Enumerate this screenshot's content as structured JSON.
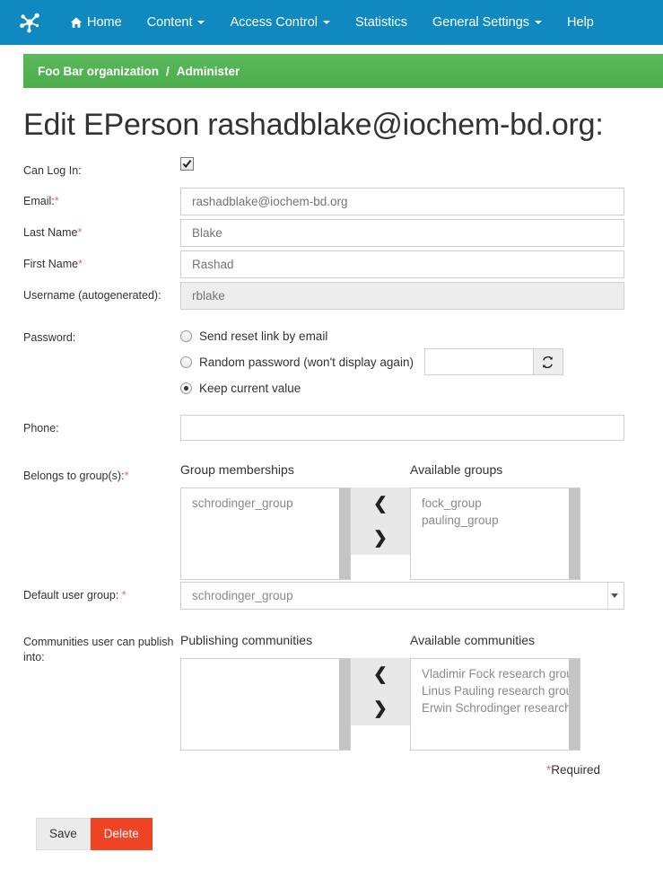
{
  "navbar": {
    "brand_icon": "molecule-logo-icon",
    "bg_color": "#1089c0",
    "items": [
      {
        "label": "Home",
        "icon": "home-icon",
        "caret": false
      },
      {
        "label": "Content",
        "icon": null,
        "caret": true
      },
      {
        "label": "Access Control",
        "icon": null,
        "caret": true
      },
      {
        "label": "Statistics",
        "icon": null,
        "caret": false
      },
      {
        "label": "General Settings",
        "icon": null,
        "caret": true
      },
      {
        "label": "Help",
        "icon": null,
        "caret": false
      }
    ]
  },
  "breadcrumb": {
    "bg_color": "#5cb85c",
    "root": "Foo Bar organization",
    "separator": "/",
    "current": "Administer"
  },
  "page": {
    "title": "Edit EPerson rashadblake@iochem-bd.org:"
  },
  "form": {
    "can_login": {
      "label": "Can Log In:",
      "checked": true,
      "icon": "checkmark-icon"
    },
    "email": {
      "label": "Email:",
      "required": true,
      "value": "rashadblake@iochem-bd.org",
      "placeholder": "rashadblake@iochem-bd.org"
    },
    "last_name": {
      "label": "Last Name",
      "required": true,
      "value": "Blake",
      "placeholder": "Blake"
    },
    "first_name": {
      "label": "First Name",
      "required": true,
      "value": "Rashad",
      "placeholder": "Rashad"
    },
    "username": {
      "label": "Username (autogenerated):",
      "required": false,
      "value": "rblake",
      "placeholder": "rblake"
    },
    "password": {
      "label": "Password:",
      "options": [
        {
          "label": "Send reset link by email",
          "selected": false
        },
        {
          "label": "Random password (won't display again)",
          "selected": false
        },
        {
          "label": "Keep current value",
          "selected": true
        }
      ],
      "random_value": "",
      "refresh_icon": "refresh-icon"
    },
    "phone": {
      "label": "Phone:",
      "value": "",
      "placeholder": ""
    },
    "groups": {
      "label": "Belongs to group(s):",
      "required": true,
      "left_header": "Group memberships",
      "right_header": "Available groups",
      "memberships": [
        "schrodinger_group"
      ],
      "available": [
        "fock_group",
        "pauling_group"
      ],
      "move_left_icon": "chevron-left-icon",
      "move_right_icon": "chevron-right-icon"
    },
    "default_group": {
      "label": "Default user group:",
      "required": true,
      "value": "schrodinger_group",
      "arrow_icon": "chevron-down-icon"
    },
    "communities": {
      "label": "Communities user can publish into:",
      "left_header": "Publishing communities",
      "right_header": "Available communities",
      "publishing": [],
      "available": [
        "Vladimir Fock research group",
        "Linus Pauling research group",
        "Erwin Schrodinger research group"
      ],
      "move_left_icon": "chevron-left-icon",
      "move_right_icon": "chevron-right-icon"
    },
    "required_note": {
      "star": "*",
      "text": "Required"
    }
  },
  "actions": {
    "save_label": "Save",
    "delete_label": "Delete",
    "delete_color": "#ef4323"
  }
}
